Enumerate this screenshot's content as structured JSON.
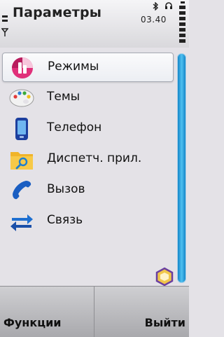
{
  "header": {
    "title": "Параметры",
    "time": "03.40"
  },
  "menu": {
    "items": [
      {
        "label": "Режимы",
        "icon": "profiles-icon",
        "selected": true
      },
      {
        "label": "Темы",
        "icon": "palette-icon"
      },
      {
        "label": "Телефон",
        "icon": "phone-device-icon"
      },
      {
        "label": "Диспетч. прил.",
        "icon": "app-manager-folder-icon"
      },
      {
        "label": "Вызов",
        "icon": "call-handset-icon"
      },
      {
        "label": "Связь",
        "icon": "connectivity-arrows-icon"
      }
    ]
  },
  "softkeys": {
    "left": "Функции",
    "right": "Выйти"
  },
  "colors": {
    "accent": "#1e8fd0",
    "background": "#e4e2e7"
  }
}
